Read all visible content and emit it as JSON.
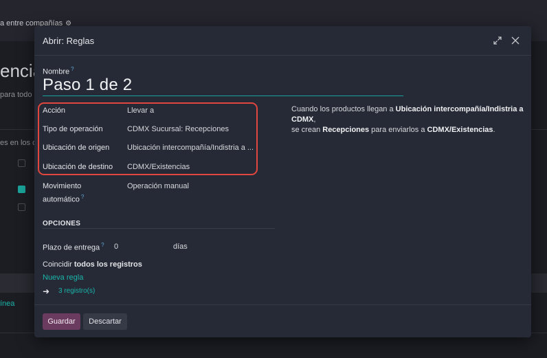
{
  "background": {
    "company_text": "a entre compañías",
    "page_title": "encia",
    "subtitle": "para todo",
    "subtitle2": "es en los q",
    "linea": "ínea"
  },
  "modal": {
    "title": "Abrir: Reglas",
    "name_label": "Nombre",
    "name_value": "Paso 1 de 2",
    "fields": [
      {
        "label": "Acción",
        "value": "Llevar a"
      },
      {
        "label": "Tipo de operación",
        "value": "CDMX Sucursal: Recepciones"
      },
      {
        "label": "Ubicación de origen",
        "value": "Ubicación intercompañía/Indistria a ..."
      },
      {
        "label": "Ubicación de destino",
        "value": "CDMX/Existencias"
      },
      {
        "label_line1": "Movimiento",
        "label_line2": "automático",
        "value": "Operación manual"
      }
    ],
    "description": {
      "p1": "Cuando los productos llegan a ",
      "p1_bold": "Ubicación intercompañía/Indistria a CDMX",
      "p1_end": ",",
      "p2": "se crean ",
      "p2_bold": "Recepciones",
      "p2_mid": " para enviarlos a ",
      "p2_bold2": "CDMX/Existencias",
      "p2_end": "."
    },
    "options_title": "OPCIONES",
    "lead_time_label": "Plazo de entrega",
    "lead_time_value": "0",
    "lead_time_unit": "días",
    "match_prefix": "Coincidir ",
    "match_bold": "todos los registros",
    "new_rule": "Nueva regla",
    "records": "3 registro(s)",
    "save_button": "Guardar",
    "discard_button": "Descartar"
  },
  "colors": {
    "accent": "#1aa39a",
    "primary": "#6b3a5f",
    "highlight": "#e2463d"
  }
}
